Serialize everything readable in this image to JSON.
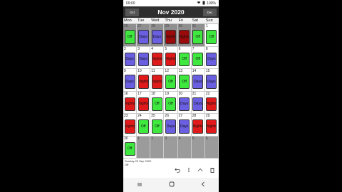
{
  "status": {
    "time": "09:00",
    "battery": "100%",
    "wifi_icon": "wifi-icon",
    "battery_icon": "battery-icon"
  },
  "header": {
    "prev_label": "Oct",
    "next_label": "Dec",
    "title": "Nov 2020"
  },
  "weekdays": [
    "Mon",
    "Tue",
    "Wed",
    "Thu",
    "Fri",
    "Sat",
    "Sun"
  ],
  "weeks": [
    [
      {
        "n": "26",
        "type": "off",
        "label": "Off",
        "state": "pastsel"
      },
      {
        "n": "27",
        "type": "days",
        "label": "Days",
        "state": "pastsel"
      },
      {
        "n": "28",
        "type": "days",
        "label": "Days",
        "state": "pastsel"
      },
      {
        "n": "29",
        "type": "nights-dark",
        "label": "Nights",
        "state": "pastsel"
      },
      {
        "n": "30",
        "type": "nights-dark",
        "label": "Nights",
        "state": "pastsel"
      },
      {
        "n": "31",
        "type": "off",
        "label": "Off",
        "state": "pastsel"
      },
      {
        "n": "1",
        "type": "off",
        "label": "Off",
        "state": ""
      }
    ],
    [
      {
        "n": "2",
        "type": "days",
        "label": "Days",
        "state": ""
      },
      {
        "n": "3",
        "type": "days",
        "label": "Days",
        "state": ""
      },
      {
        "n": "4",
        "type": "nights",
        "label": "Nights",
        "state": ""
      },
      {
        "n": "5",
        "type": "nights",
        "label": "Nights",
        "state": ""
      },
      {
        "n": "6",
        "type": "off",
        "label": "Off",
        "state": ""
      },
      {
        "n": "7",
        "type": "off",
        "label": "Off",
        "state": ""
      },
      {
        "n": "8",
        "type": "days",
        "label": "Days",
        "state": ""
      }
    ],
    [
      {
        "n": "9",
        "type": "days",
        "label": "Days",
        "state": ""
      },
      {
        "n": "10",
        "type": "nights",
        "label": "Nights",
        "state": ""
      },
      {
        "n": "11",
        "type": "nights",
        "label": "Nights",
        "state": ""
      },
      {
        "n": "12",
        "type": "off",
        "label": "Off",
        "state": ""
      },
      {
        "n": "13",
        "type": "off",
        "label": "Off",
        "state": ""
      },
      {
        "n": "14",
        "type": "days",
        "label": "Days",
        "state": ""
      },
      {
        "n": "15",
        "type": "days",
        "label": "Days",
        "state": ""
      }
    ],
    [
      {
        "n": "16",
        "type": "nights",
        "label": "Nights",
        "state": ""
      },
      {
        "n": "17",
        "type": "nights",
        "label": "Nights",
        "state": ""
      },
      {
        "n": "18",
        "type": "off",
        "label": "Off",
        "state": ""
      },
      {
        "n": "19",
        "type": "off",
        "label": "Off",
        "state": ""
      },
      {
        "n": "20",
        "type": "days",
        "label": "Days",
        "state": ""
      },
      {
        "n": "21",
        "type": "days",
        "label": "Days",
        "state": ""
      },
      {
        "n": "22",
        "type": "nights",
        "label": "Nights",
        "state": ""
      }
    ],
    [
      {
        "n": "23",
        "type": "nights",
        "label": "Nights",
        "state": ""
      },
      {
        "n": "24",
        "type": "off",
        "label": "Off",
        "state": ""
      },
      {
        "n": "25",
        "type": "off",
        "label": "Off",
        "state": ""
      },
      {
        "n": "26",
        "type": "days",
        "label": "Days",
        "state": ""
      },
      {
        "n": "27",
        "type": "days",
        "label": "Days",
        "state": ""
      },
      {
        "n": "28",
        "type": "nights",
        "label": "Nights",
        "state": ""
      },
      {
        "n": "29",
        "type": "nights",
        "label": "Nights",
        "state": ""
      }
    ],
    [
      {
        "n": "30",
        "type": "off",
        "label": "Off",
        "state": ""
      },
      {
        "n": "1",
        "type": "",
        "label": "",
        "state": "out"
      },
      {
        "n": "2",
        "type": "",
        "label": "",
        "state": "out"
      },
      {
        "n": "3",
        "type": "",
        "label": "",
        "state": "out"
      },
      {
        "n": "4",
        "type": "",
        "label": "",
        "state": "out"
      },
      {
        "n": "5",
        "type": "",
        "label": "",
        "state": "out"
      },
      {
        "n": "6",
        "type": "",
        "label": "",
        "state": "out"
      }
    ]
  ],
  "footer": {
    "date_line": "Sunday 20 Sep 2020",
    "shift_line": "Off"
  },
  "actions": {
    "undo_icon": "undo-icon",
    "more_icon": "more-vert-icon",
    "up_icon": "chevron-up-icon",
    "delete_icon": "trash-icon"
  },
  "navbar": {
    "recents_icon": "recents-icon",
    "home_icon": "home-icon",
    "back_icon": "back-icon"
  },
  "colors": {
    "off": "#3ee83e",
    "days": "#6a5fe0",
    "nights": "#e01a1a",
    "header": "#2f2f2f"
  }
}
